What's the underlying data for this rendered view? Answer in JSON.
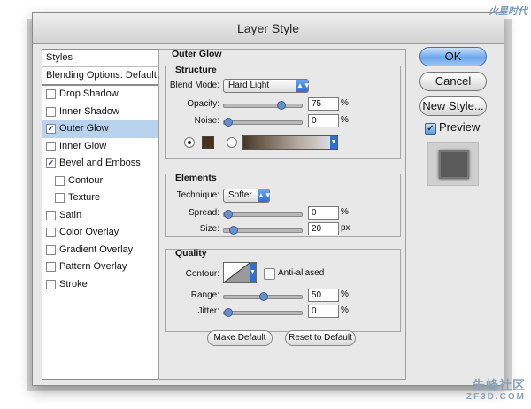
{
  "window": {
    "title": "Layer Style"
  },
  "watermark": {
    "top": "火星时代",
    "bottom": "朱峰社区",
    "bottom_sub": "ZF3D.COM"
  },
  "styles_panel": {
    "header": "Styles",
    "blending_options": "Blending Options: Default",
    "items": [
      {
        "label": "Drop Shadow",
        "checked": false,
        "selected": false,
        "indent": false
      },
      {
        "label": "Inner Shadow",
        "checked": false,
        "selected": false,
        "indent": false
      },
      {
        "label": "Outer Glow",
        "checked": true,
        "selected": true,
        "indent": false
      },
      {
        "label": "Inner Glow",
        "checked": false,
        "selected": false,
        "indent": false
      },
      {
        "label": "Bevel and Emboss",
        "checked": true,
        "selected": false,
        "indent": false
      },
      {
        "label": "Contour",
        "checked": false,
        "selected": false,
        "indent": true
      },
      {
        "label": "Texture",
        "checked": false,
        "selected": false,
        "indent": true
      },
      {
        "label": "Satin",
        "checked": false,
        "selected": false,
        "indent": false
      },
      {
        "label": "Color Overlay",
        "checked": false,
        "selected": false,
        "indent": false
      },
      {
        "label": "Gradient Overlay",
        "checked": false,
        "selected": false,
        "indent": false
      },
      {
        "label": "Pattern Overlay",
        "checked": false,
        "selected": false,
        "indent": false
      },
      {
        "label": "Stroke",
        "checked": false,
        "selected": false,
        "indent": false
      }
    ]
  },
  "outer_glow": {
    "title": "Outer Glow",
    "structure": {
      "title": "Structure",
      "blend_mode_label": "Blend Mode:",
      "blend_mode_value": "Hard Light",
      "opacity_label": "Opacity:",
      "opacity_value": "75",
      "opacity_level": 0.75,
      "noise_label": "Noise:",
      "noise_value": "0",
      "noise_level": 0,
      "unit": "%",
      "glow_color": "#4a3218"
    },
    "elements": {
      "title": "Elements",
      "technique_label": "Technique:",
      "technique_value": "Softer",
      "spread_label": "Spread:",
      "spread_value": "0",
      "spread_unit": "%",
      "spread_level": 0,
      "size_label": "Size:",
      "size_value": "20",
      "size_unit": "px",
      "size_level": 0.08
    },
    "quality": {
      "title": "Quality",
      "contour_label": "Contour:",
      "anti_aliased_label": "Anti-aliased",
      "anti_aliased": false,
      "range_label": "Range:",
      "range_value": "50",
      "range_unit": "%",
      "range_level": 0.5,
      "jitter_label": "Jitter:",
      "jitter_value": "0",
      "jitter_unit": "%",
      "jitter_level": 0
    },
    "make_default": "Make Default",
    "reset_default": "Reset to Default"
  },
  "actions": {
    "ok": "OK",
    "cancel": "Cancel",
    "new_style": "New Style...",
    "preview_label": "Preview",
    "preview_checked": true
  }
}
